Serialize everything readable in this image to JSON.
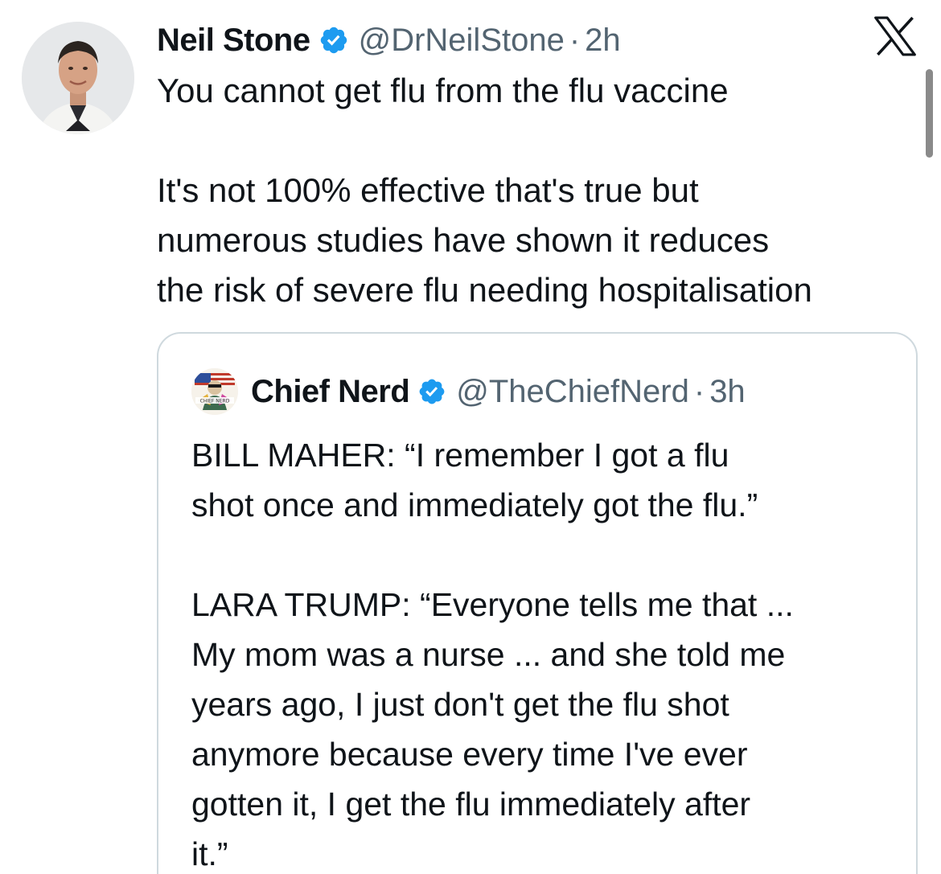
{
  "tweet": {
    "author_name": "Neil Stone",
    "handle": "@DrNeilStone",
    "separator": "·",
    "time": "2h",
    "lines": [
      "You cannot get flu from the flu vaccine",
      "",
      "It's not 100% effective that's true but",
      "numerous studies have shown it reduces",
      "the risk of severe flu needing hospitalisation"
    ]
  },
  "quote": {
    "author_name": "Chief Nerd",
    "handle": "@TheChiefNerd",
    "separator": "·",
    "time": "3h",
    "avatar_caption": "CHIEF NERD",
    "lines": [
      "BILL MAHER: “I remember I got a flu",
      "shot once and immediately got the flu.”",
      "",
      "LARA TRUMP: “Everyone tells me that ...",
      "My mom was a nurse ... and she told me",
      "years ago, I just don't get the flu shot",
      "anymore because every time I've ever",
      "gotten it, I get the flu immediately after",
      "it.”"
    ]
  },
  "icons": {
    "verified": "verified-badge-icon",
    "platform_logo": "x-logo-icon"
  },
  "colors": {
    "text": "#0f1419",
    "secondary": "#536471",
    "verified": "#1d9bf0",
    "border": "#cfd9de"
  }
}
